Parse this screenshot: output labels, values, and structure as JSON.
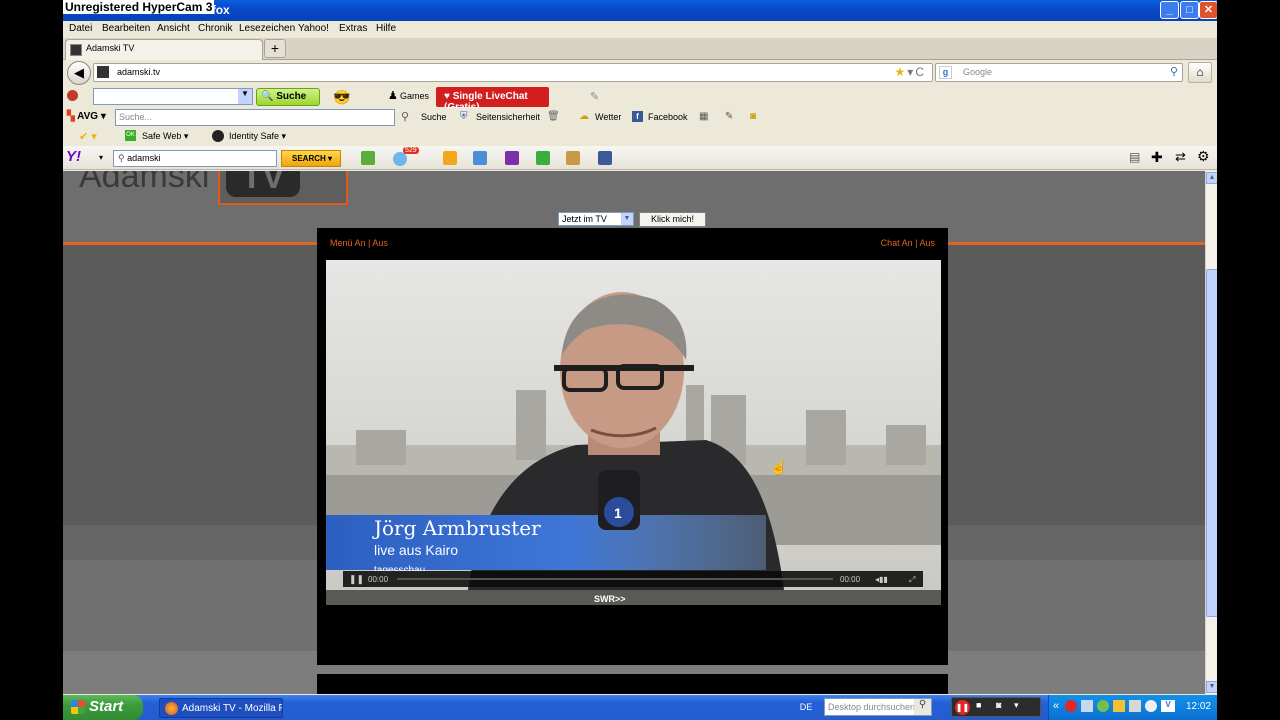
{
  "recorder_banner": "Unregistered HyperCam 3",
  "window": {
    "title": "Adamski TV - Mozilla Firefox",
    "controls": {
      "minimize": "_",
      "maximize": "□",
      "close": "✕"
    }
  },
  "menubar": [
    "Datei",
    "Bearbeiten",
    "Ansicht",
    "Chronik",
    "Lesezeichen",
    "Yahoo!",
    "Extras",
    "Hilfe"
  ],
  "tabs": [
    {
      "label": "Adamski TV",
      "icon": "site-favicon"
    }
  ],
  "new_tab_symbol": "+",
  "address_bar": {
    "url": "adamski.tv",
    "reload_symbol": "C"
  },
  "google_search": {
    "placeholder": "Google"
  },
  "toolbar1": {
    "suche_button": "Suche",
    "games": "Games",
    "livechat_button": "Single LiveChat (Gratis)"
  },
  "toolbar_avg": {
    "brand": "AVG",
    "search_placeholder": "Suche...",
    "search_button": "Suche",
    "security": "Seitensicherheit",
    "weather": "Wetter",
    "facebook": "Facebook"
  },
  "toolbar_norton": {
    "safe_web": "Safe Web",
    "identity_safe": "Identity Safe"
  },
  "toolbar_yahoo": {
    "logo": "Y!",
    "search_value": "adamski",
    "search_button": "SEARCH",
    "mail_badge": "529"
  },
  "page": {
    "logo_text": "Adamski",
    "logo_tv": "TV",
    "channel_select": "Jetzt im TV",
    "klick_button": "Klick mich!",
    "menu_toggle": "Menü An | Aus",
    "chat_toggle": "Chat An | Aus",
    "video": {
      "name": "Jörg Armbruster",
      "subtitle": "live aus Kairo",
      "program": "tagesschau",
      "badge": "SWR>>",
      "logo_ard": "1",
      "time_current": "00:00",
      "time_total": "00:00"
    }
  },
  "taskbar": {
    "start": "Start",
    "window_button": "Adamski TV - Mozilla F...",
    "language": "DE",
    "desktop_search_placeholder": "Desktop durchsuchen",
    "clock": "12:02"
  }
}
